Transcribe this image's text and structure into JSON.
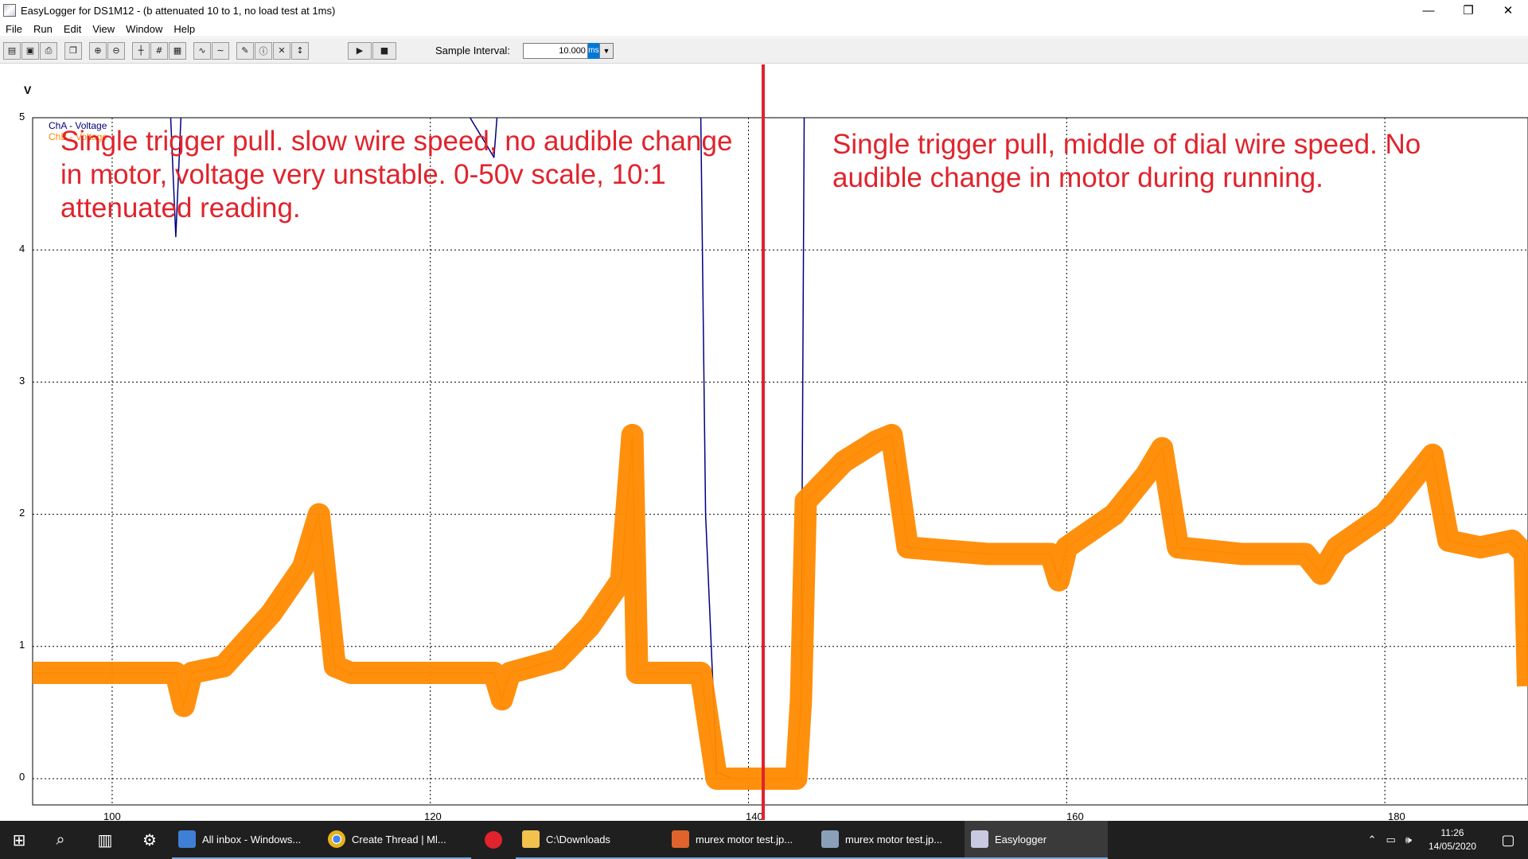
{
  "window": {
    "title": "EasyLogger for DS1M12 - (b attenuated 10 to 1, no load test at 1ms)",
    "minimize": "—",
    "restore": "❐",
    "close": "✕"
  },
  "menu": [
    "File",
    "Run",
    "Edit",
    "View",
    "Window",
    "Help"
  ],
  "toolbar": {
    "sample_interval_label": "Sample Interval:",
    "sample_interval_value": "10.000",
    "sample_interval_unit": "ms",
    "play": "▶",
    "stop": "■"
  },
  "chart_data": {
    "type": "line",
    "ylabel": "V",
    "ylim": [
      0,
      5
    ],
    "xlim": [
      95,
      189
    ],
    "yticks": [
      "5",
      "4",
      "3",
      "2",
      "1",
      "0"
    ],
    "xticks": [
      "100",
      "120",
      "140",
      "160",
      "180"
    ],
    "grid": true,
    "legend": {
      "placement": "top-left",
      "entries": [
        "ChA - Voltage",
        "ChB - Voltage"
      ]
    },
    "series": [
      {
        "name": "ChA - Voltage",
        "color": "#000080",
        "x": [
          95,
          99,
          103.5,
          104,
          104.5,
          105,
          120,
          124,
          124.5,
          125,
          130,
          137,
          137.3,
          138,
          139,
          140,
          141,
          143,
          143.3,
          143.5,
          144,
          189
        ],
        "y": [
          5.5,
          5.5,
          5.5,
          4.1,
          5.5,
          5.5,
          5.5,
          4.7,
          5.5,
          5.5,
          5.5,
          5.0,
          2.0,
          0.05,
          0.0,
          0.0,
          0.0,
          0.0,
          0.55,
          5.0,
          5.5,
          5.5
        ]
      },
      {
        "name": "ChB - Voltage",
        "color": "#ff8a00",
        "x": [
          95,
          100,
          104,
          104.5,
          105,
          107,
          110,
          112,
          113,
          114,
          115,
          117,
          120,
          124,
          124.5,
          125,
          128,
          130,
          132,
          132.7,
          133,
          137,
          137.5,
          138,
          140,
          143,
          143.3,
          143.6,
          146,
          148,
          149,
          150,
          155,
          159,
          159.5,
          160,
          163,
          165,
          166,
          167,
          171,
          175,
          176,
          177,
          180,
          182,
          183,
          184,
          186,
          188,
          188.8,
          189
        ],
        "y": [
          0.8,
          0.8,
          0.8,
          0.55,
          0.8,
          0.85,
          1.25,
          1.6,
          2.0,
          0.85,
          0.8,
          0.8,
          0.8,
          0.8,
          0.6,
          0.8,
          0.9,
          1.15,
          1.5,
          2.6,
          0.8,
          0.8,
          0.4,
          0.0,
          0.0,
          0.0,
          0.6,
          2.1,
          2.4,
          2.55,
          2.6,
          1.75,
          1.7,
          1.7,
          1.5,
          1.75,
          2.0,
          2.3,
          2.5,
          1.75,
          1.7,
          1.7,
          1.55,
          1.75,
          2.0,
          2.3,
          2.45,
          1.8,
          1.75,
          1.8,
          1.7,
          0.7
        ]
      }
    ],
    "annotations": [
      "Single trigger pull. slow wire speed, no audible change in motor, voltage very unstable. 0-50v scale, 10:1 attenuated reading.",
      "Single trigger pull, middle of dial wire speed. No audible change in motor during running."
    ],
    "marker_line_color": "#e0232c"
  },
  "taskbar": {
    "apps": [
      {
        "label": "All inbox - Windows...",
        "color": "#3f7fd6"
      },
      {
        "label": "Create Thread | Ml...",
        "color": "#e8b31a"
      },
      {
        "label": "",
        "color": "#e0232c"
      },
      {
        "label": "C:\\Downloads",
        "color": "#f2c14e"
      },
      {
        "label": "murex motor test.jp...",
        "color": "#e0632c"
      },
      {
        "label": "murex motor test.jp...",
        "color": "#8aa0b8"
      },
      {
        "label": "Easylogger",
        "color": "#c9c9e0"
      }
    ],
    "time": "11:26",
    "date": "14/05/2020"
  }
}
